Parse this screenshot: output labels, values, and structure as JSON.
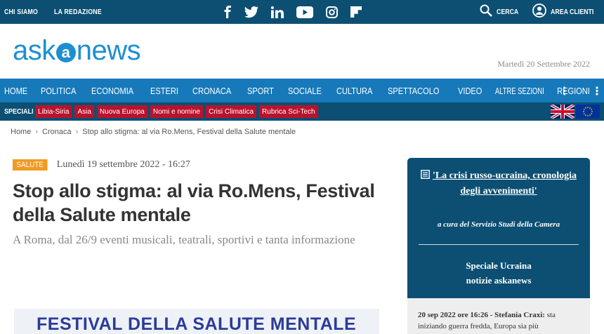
{
  "topbar": {
    "links": [
      "CHI SIAMO",
      "LA REDAZIONE"
    ],
    "social_icons": [
      "facebook-icon",
      "twitter-icon",
      "linkedin-icon",
      "youtube-icon",
      "instagram-icon",
      "flipboard-icon"
    ],
    "search_label": "CERCA",
    "client_label": "AREA CLIENTI"
  },
  "header": {
    "logo_left": "ask",
    "logo_mid": "a",
    "logo_right": "news",
    "date": "Martedì 20 Settembre 2022"
  },
  "mainnav": {
    "items": [
      "HOME",
      "POLITICA",
      "ECONOMIA",
      "ESTERI",
      "CRONACA",
      "SPORT",
      "SOCIALE",
      "CULTURA",
      "SPETTACOLO",
      "VIDEO",
      "ALTRE SEZIONI"
    ],
    "regioni": "REGIONI"
  },
  "specialbar": {
    "label": "SPECIALI",
    "tags": [
      "Libia-Siria",
      "Asia",
      "Nuova Europa",
      "Nomi e nomine",
      "Crisi Climatica",
      "Rubrica Sci-Tech"
    ]
  },
  "breadcrumb": {
    "home": "Home",
    "section": "Cronaca",
    "current": "Stop allo stigma: al via Ro.Mens, Festival della Salute mentale"
  },
  "article": {
    "category": "SALUTE",
    "date": "Lunedì 19 settembre 2022 - 16:27",
    "title": "Stop allo stigma: al via Ro.Mens, Festival della Salute mentale",
    "subtitle": "A Roma, dal 26/9 eventi musicali, teatrali, sportivi e tanta informazione",
    "banner_text": "FESTIVAL DELLA SALUTE MENTALE"
  },
  "sidebar": {
    "crisi_link": "'La crisi russo-ucraina, cronologia degli avvenimenti'",
    "cura": "a cura del Servizio Studi della Camera",
    "speciale_line1": "Speciale Ucraina",
    "speciale_line2": "notizie askanews",
    "news_meta": "20 sep 2022 ore 16:26 - Stefania Craxi:",
    "news_text": "sta iniziando guerra fredda, Europa sia più"
  },
  "colors": {
    "dark_blue": "#0c4f73",
    "nav_blue": "#1779ba",
    "logo_blue": "#1d8fd1",
    "tag_red": "#b8132e",
    "category_orange": "#f39a21"
  }
}
